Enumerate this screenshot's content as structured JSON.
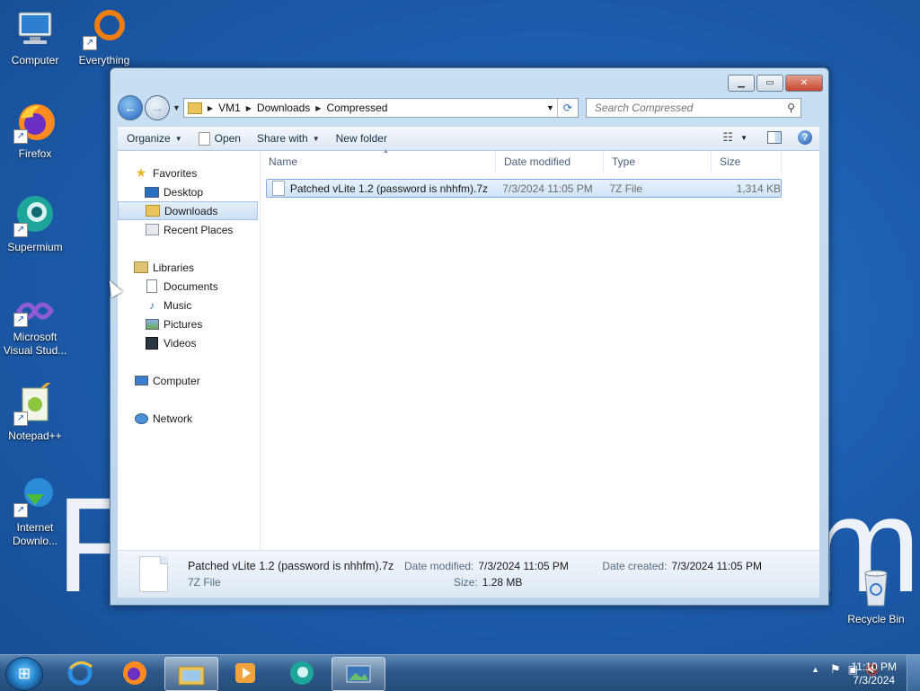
{
  "desktop": {
    "watermark_left": "F",
    "watermark_right": "m",
    "icons": [
      {
        "label": "Computer",
        "icon": "computer-icon"
      },
      {
        "label": "Everything",
        "icon": "everything-icon"
      },
      {
        "label": "Firefox",
        "icon": "firefox-icon"
      },
      {
        "label": "Supermium",
        "icon": "supermium-icon"
      },
      {
        "label": "Microsoft Visual Stud...",
        "icon": "visual-studio-icon"
      },
      {
        "label": "Notepad++",
        "icon": "notepadpp-icon"
      },
      {
        "label": "Internet Downlo...",
        "icon": "idm-icon"
      },
      {
        "label": "Recycle Bin",
        "icon": "recycle-bin-icon"
      }
    ]
  },
  "window": {
    "breadcrumb": [
      "VM1",
      "Downloads",
      "Compressed"
    ],
    "search_placeholder": "Search Compressed",
    "toolbar": {
      "organize": "Organize",
      "open": "Open",
      "share_with": "Share with",
      "new_folder": "New folder"
    },
    "nav": {
      "favorites": "Favorites",
      "desktop": "Desktop",
      "downloads": "Downloads",
      "recent": "Recent Places",
      "libraries": "Libraries",
      "documents": "Documents",
      "music": "Music",
      "pictures": "Pictures",
      "videos": "Videos",
      "computer": "Computer",
      "network": "Network"
    },
    "columns": {
      "name": "Name",
      "date": "Date modified",
      "type": "Type",
      "size": "Size"
    },
    "files": [
      {
        "name": "Patched vLite 1.2 (password is nhhfm).7z",
        "date": "7/3/2024 11:05 PM",
        "type": "7Z File",
        "size": "1,314 KB"
      }
    ],
    "details": {
      "name": "Patched vLite 1.2 (password is nhhfm).7z",
      "type": "7Z File",
      "date_modified_label": "Date modified:",
      "date_modified": "7/3/2024 11:05 PM",
      "size_label": "Size:",
      "size": "1.28 MB",
      "date_created_label": "Date created:",
      "date_created": "7/3/2024 11:05 PM"
    }
  },
  "taskbar": {
    "time": "11:10 PM",
    "date": "7/3/2024"
  }
}
